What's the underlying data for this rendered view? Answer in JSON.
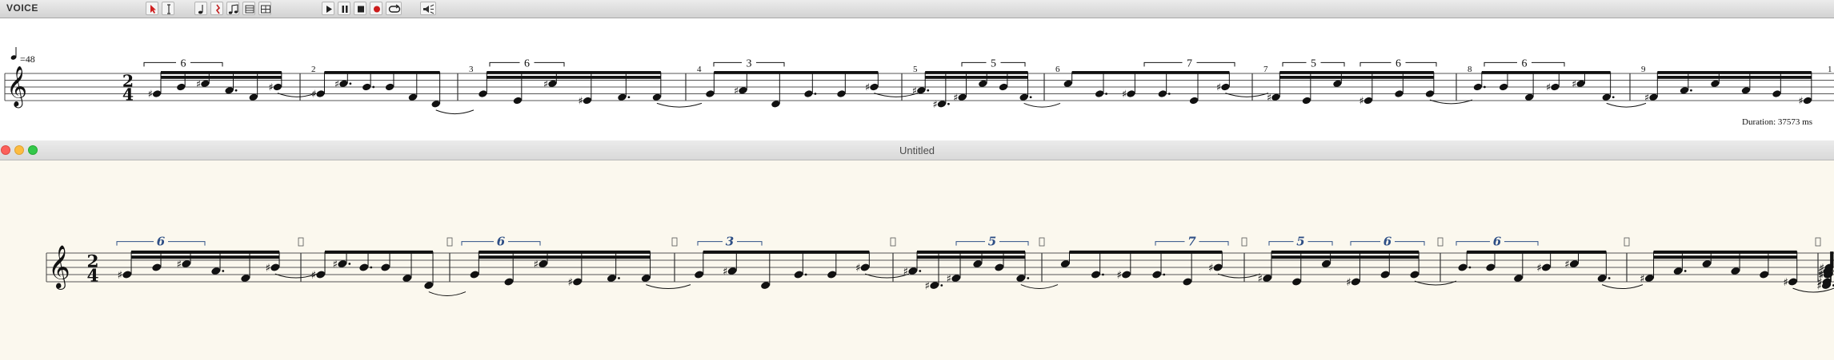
{
  "top_window": {
    "label": "VOICE",
    "tools": [
      {
        "name": "arrow-tool-icon"
      },
      {
        "name": "text-cursor-tool-icon"
      },
      {
        "name": "note-tool-icon"
      },
      {
        "name": "rest-tool-icon"
      },
      {
        "name": "beamed-notes-tool-icon"
      },
      {
        "name": "chord-tool-icon"
      },
      {
        "name": "score-grid-tool-icon"
      },
      {
        "name": "play-icon"
      },
      {
        "name": "pause-icon"
      },
      {
        "name": "stop-icon"
      },
      {
        "name": "record-icon"
      },
      {
        "name": "loop-icon"
      },
      {
        "name": "speaker-settings-icon"
      }
    ],
    "score": {
      "tempo_label": "=48",
      "time_signature": {
        "top": "2",
        "bottom": "4"
      },
      "measure_numbers": [
        "2",
        "3",
        "4",
        "5",
        "6",
        "7",
        "8",
        "9",
        "1"
      ],
      "tuplets": [
        "6",
        "6",
        "3",
        "5",
        "7",
        "5",
        "6",
        "6"
      ]
    },
    "duration": "Duration: 37573 ms"
  },
  "bottom_window": {
    "title": "Untitled",
    "score": {
      "time_signature": {
        "top": "2",
        "bottom": "4"
      },
      "tuplets": [
        "6",
        "6",
        "3",
        "5",
        "7",
        "5",
        "6",
        "6"
      ]
    }
  },
  "colors": {
    "toolbar_bg": "#dcdcdc",
    "paper": "#fbf8ee",
    "tuplet_blue": "#2e4f86",
    "close": "#fc605b",
    "minimize": "#fdbc40",
    "zoom": "#34c84a",
    "record_red": "#cc1c1c",
    "arrow_red": "#d02020"
  }
}
